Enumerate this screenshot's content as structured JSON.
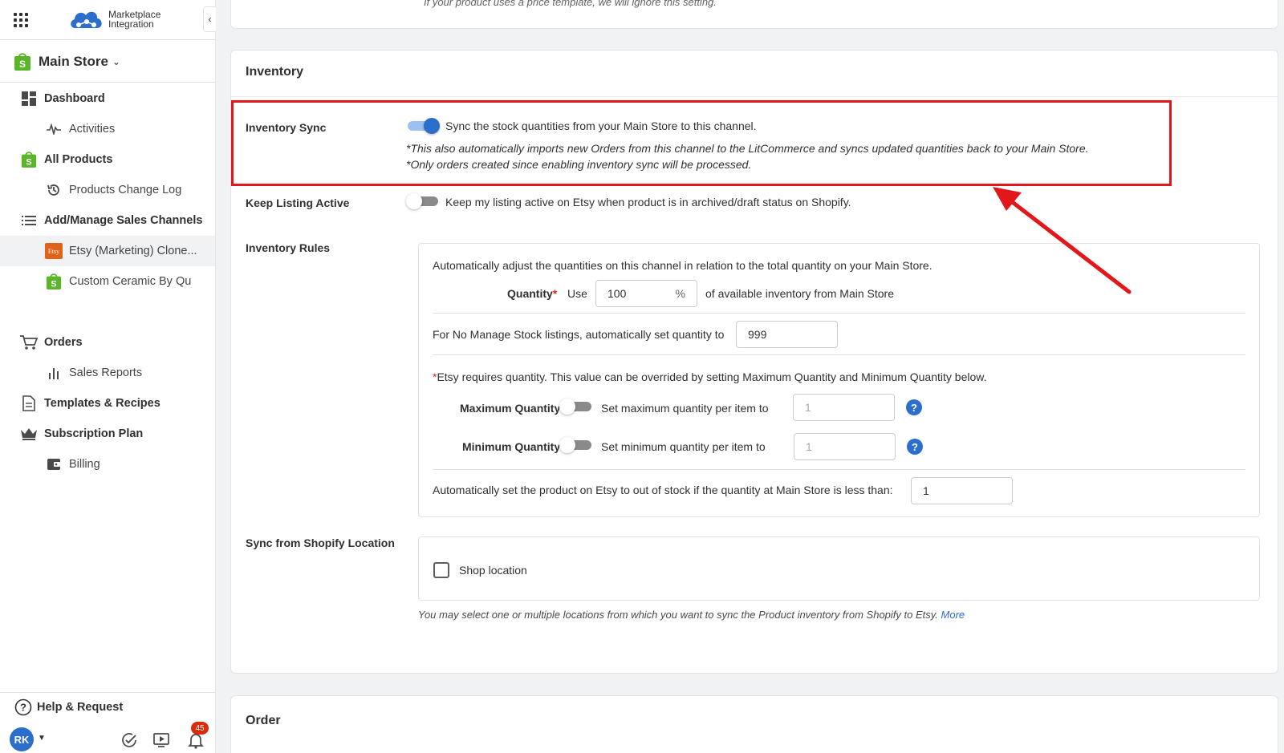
{
  "brand": {
    "line1": "Marketplace",
    "line2": "Integration"
  },
  "store": {
    "name": "Main Store"
  },
  "nav": {
    "dashboard": "Dashboard",
    "activities": "Activities",
    "all_products": "All Products",
    "products_change_log": "Products Change Log",
    "sales_channels": "Add/Manage Sales Channels",
    "etsy_channel": "Etsy (Marketing) Clone...",
    "custom_ceramic": "Custom Ceramic By Qu",
    "orders": "Orders",
    "sales_reports": "Sales Reports",
    "templates": "Templates & Recipes",
    "subscription": "Subscription Plan",
    "billing": "Billing",
    "etsy_badge": "Etsy"
  },
  "footer": {
    "help": "Help & Request",
    "avatar": "RK",
    "notifications": "45"
  },
  "top_note": "If your product uses a price template, we will ignore this setting.",
  "inventory": {
    "title": "Inventory",
    "sync_label": "Inventory Sync",
    "sync_on": true,
    "sync_text": "Sync the stock quantities from your Main Store to this channel.",
    "sync_note1": "*This also automatically imports new Orders from this channel to the LitCommerce and syncs updated quantities back to your Main Store.",
    "sync_note2": "*Only orders created since enabling inventory sync will be processed.",
    "keep_label": "Keep Listing Active",
    "keep_on": false,
    "keep_text": "Keep my listing active on Etsy when product is in archived/draft status on Shopify.",
    "rules_label": "Inventory Rules",
    "rules_intro": "Automatically adjust the quantities on this channel in relation to the total quantity on your Main Store.",
    "quantity_label": "Quantity",
    "quantity_req": "*",
    "use_label": "Use",
    "quantity_value": "100",
    "percent": "%",
    "quantity_suffix": "of available inventory from Main Store",
    "no_manage_label": "For No Manage Stock listings, automatically set quantity to",
    "no_manage_value": "999",
    "etsy_req_star": "*",
    "etsy_req_text": "Etsy requires quantity. This value can be overrided by setting Maximum Quantity and Minimum Quantity below.",
    "max_label": "Maximum Quantity",
    "max_text": "Set maximum quantity per item to",
    "max_placeholder": "1",
    "min_label": "Minimum Quantity",
    "min_text": "Set minimum quantity per item to",
    "min_placeholder": "1",
    "oos_label": "Automatically set the product on Etsy to out of stock if the quantity at Main Store is less than:",
    "oos_value": "1",
    "location_label": "Sync from Shopify Location",
    "location_option": "Shop location",
    "location_note": "You may select one or multiple locations from which you want to sync the Product inventory from Shopify to Etsy.",
    "location_more": "More",
    "help_glyph": "?"
  },
  "order": {
    "title": "Order"
  },
  "colors": {
    "accent": "#2c6ecb",
    "highlight": "#e3161b",
    "shopify_green": "#5ab52b",
    "etsy_orange": "#e0631a"
  }
}
